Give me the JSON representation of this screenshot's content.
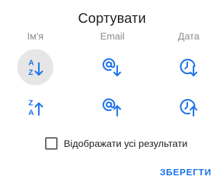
{
  "dialog": {
    "title": "Сортувати",
    "columns": {
      "name": "Ім'я",
      "email": "Email",
      "date": "Дата"
    },
    "sort_options": [
      {
        "id": "name-asc",
        "icon": "sort-az-ascending-icon",
        "letters_top": "A",
        "letters_bottom": "Z",
        "selected": true
      },
      {
        "id": "email-asc",
        "icon": "at-sign-arrow-down-icon",
        "selected": false
      },
      {
        "id": "date-asc",
        "icon": "clock-arrow-down-icon",
        "selected": false
      },
      {
        "id": "name-desc",
        "icon": "sort-za-descending-icon",
        "letters_top": "Z",
        "letters_bottom": "A",
        "selected": false
      },
      {
        "id": "email-desc",
        "icon": "at-sign-arrow-up-icon",
        "selected": false
      },
      {
        "id": "date-desc",
        "icon": "clock-arrow-up-icon",
        "selected": false
      }
    ],
    "show_all_results": {
      "label": "Відображати усі результати",
      "checked": false
    },
    "save_label": "ЗБЕРЕГТИ"
  },
  "colors": {
    "accent": "#1a73e8",
    "selected_background": "#e6e6e6",
    "text": "#202124",
    "muted_text": "#8a8a8a"
  }
}
